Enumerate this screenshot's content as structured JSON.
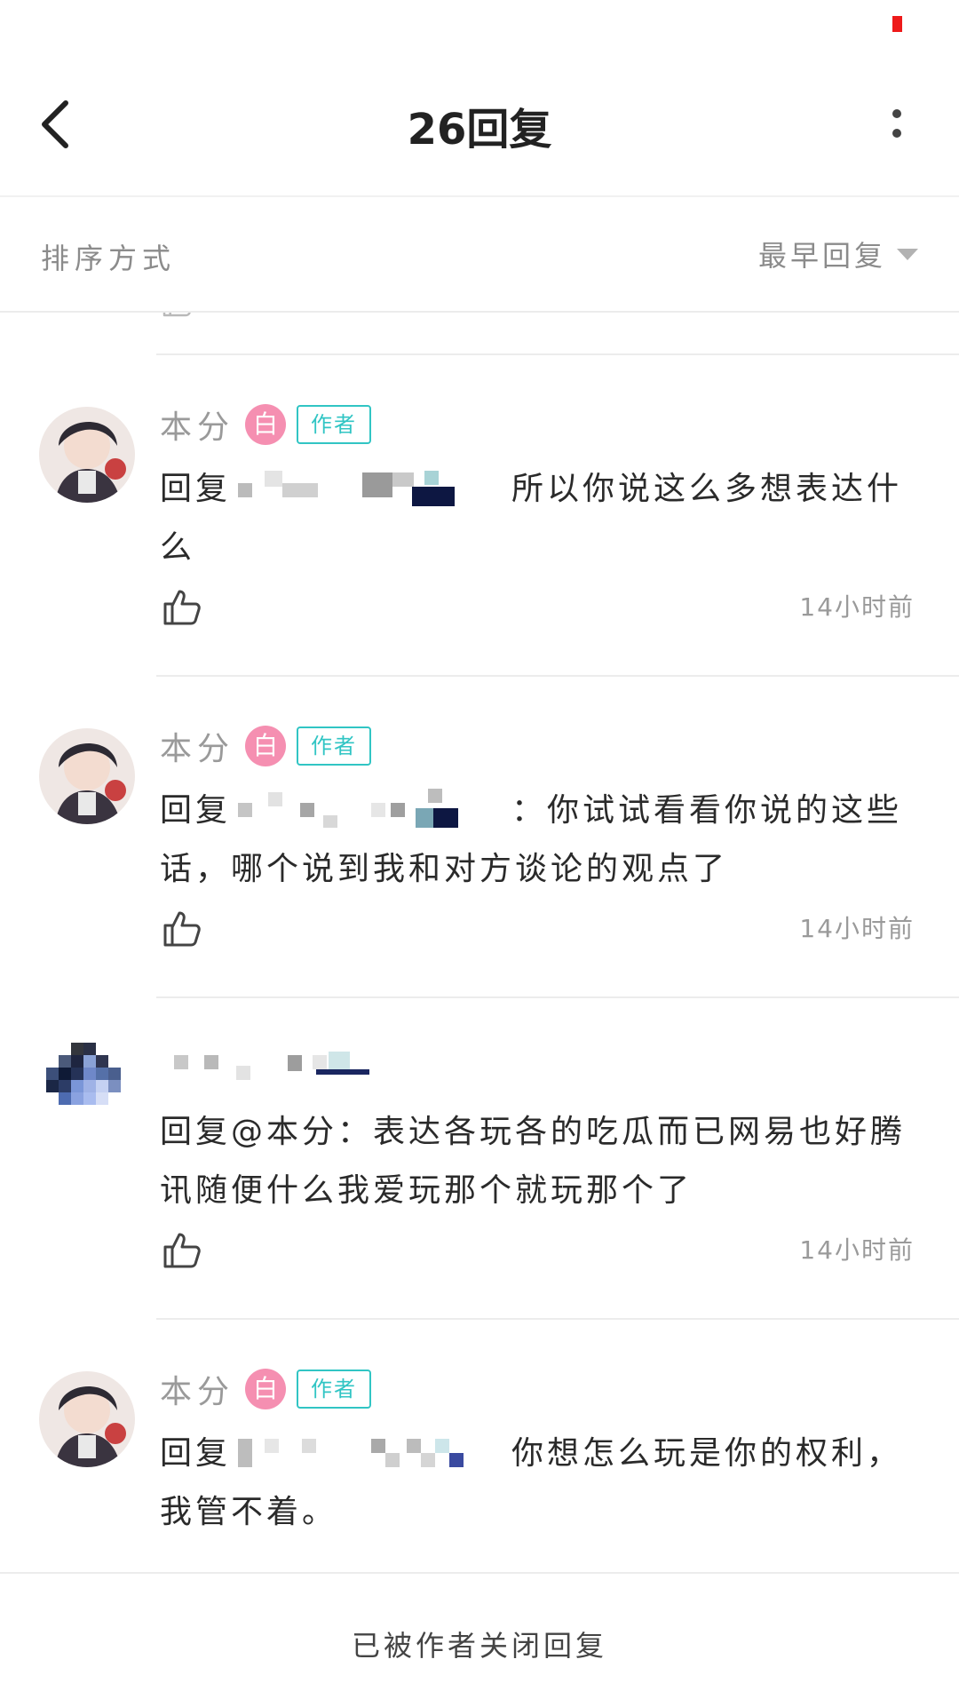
{
  "header": {
    "title": "26回复"
  },
  "sort": {
    "label": "排序方式",
    "value": "最早回复"
  },
  "replies": [
    {
      "author": "本分",
      "level": "白",
      "tag": "作者",
      "prefix": "回复",
      "text": "所以你说这么多想表达什么",
      "time": "14小时前"
    },
    {
      "author": "本分",
      "level": "白",
      "tag": "作者",
      "prefix": "回复",
      "text": "：你试试看看你说的这些话，哪个说到我和对方谈论的观点了",
      "time": "14小时前"
    },
    {
      "author": "",
      "prefix": "回复@本分：",
      "text": "表达各玩各的吃瓜而已网易也好腾讯随便什么我爱玩那个就玩那个了",
      "time": "14小时前"
    },
    {
      "author": "本分",
      "level": "白",
      "tag": "作者",
      "prefix": "回复",
      "text": "你想怎么玩是你的权利，我管不着。",
      "time": ""
    }
  ],
  "footer": {
    "closed_text": "已被作者关闭回复"
  },
  "colors": {
    "accent_tag": "#31c5c4",
    "level_badge": "#f58fb1",
    "status_indicator": "#ee1a1a"
  },
  "icons": {
    "back": "chevron-left-icon",
    "more": "more-vertical-icon",
    "like": "thumbs-up-icon",
    "sort": "caret-down-icon"
  }
}
